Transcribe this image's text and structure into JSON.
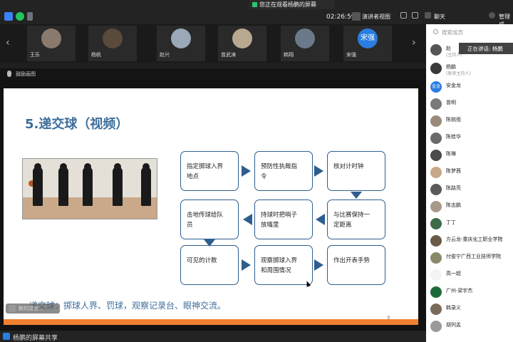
{
  "app": {
    "share_banner": "您正在观看杨鹏的屏幕",
    "timer": "02:26:59",
    "view_mode": "演讲者视图",
    "chat_tab": "聊天",
    "manage_tab": "管理成"
  },
  "participants_strip": [
    {
      "name": "王乐",
      "avatar": ""
    },
    {
      "name": "杨帆",
      "avatar": ""
    },
    {
      "name": "赵兴",
      "avatar": ""
    },
    {
      "name": "曾武涛",
      "avatar": ""
    },
    {
      "name": "韩翔",
      "avatar": ""
    },
    {
      "name": "宋强",
      "avatar": "宋强"
    }
  ],
  "speaking_now": "鼓励画图",
  "slide": {
    "title": "5.递交球（视频）",
    "boxes": [
      {
        "text": "指定掷球入界\n地点"
      },
      {
        "text": "预防性执裁指\n令"
      },
      {
        "text": "核对计时钟"
      },
      {
        "text": "击地传球给队\n员"
      },
      {
        "text": "持球时把哨子\n放嘴里"
      },
      {
        "text": "与比赛保持一\n定距离"
      },
      {
        "text": "可见的计数"
      },
      {
        "text": "观察掷球入界\n和周围情况"
      },
      {
        "text": "作出开表手势"
      }
    ],
    "caption": "递交球：掷球人界、罚球，观察记录台、眼神交流。",
    "page_number": "9"
  },
  "ghost_label": "新的语言...",
  "share_label": "杨鹏的屏幕共享",
  "panel": {
    "search_placeholder": "搜索成员",
    "tooltip": "正在讲话: 杨鹏",
    "members": [
      {
        "name": "赵",
        "sub": "(主持人)",
        "avatar": ""
      },
      {
        "name": "杨鹏",
        "sub": "(联席主持人)",
        "avatar": ""
      },
      {
        "name": "安金龙",
        "sub": "",
        "avatar": "金龙"
      },
      {
        "name": "曾明",
        "sub": "",
        "avatar": ""
      },
      {
        "name": "陈桃祖",
        "sub": "",
        "avatar": ""
      },
      {
        "name": "陈桂华",
        "sub": "",
        "avatar": ""
      },
      {
        "name": "陈琳",
        "sub": "",
        "avatar": ""
      },
      {
        "name": "陈梦茜",
        "sub": "",
        "avatar": ""
      },
      {
        "name": "陈路亮",
        "sub": "",
        "avatar": ""
      },
      {
        "name": "陈志鹏",
        "sub": "",
        "avatar": ""
      },
      {
        "name": "丁丁",
        "sub": "",
        "avatar": ""
      },
      {
        "name": "方云龙-重庆化工职业学院",
        "sub": "",
        "avatar": ""
      },
      {
        "name": "付俊宁广西工业技师学院",
        "sub": "",
        "avatar": ""
      },
      {
        "name": "高一超",
        "sub": "",
        "avatar": ""
      },
      {
        "name": "广州·梁宇杰",
        "sub": "",
        "avatar": ""
      },
      {
        "name": "韩录义",
        "sub": "",
        "avatar": ""
      },
      {
        "name": "胡列孟",
        "sub": "",
        "avatar": ""
      }
    ]
  }
}
